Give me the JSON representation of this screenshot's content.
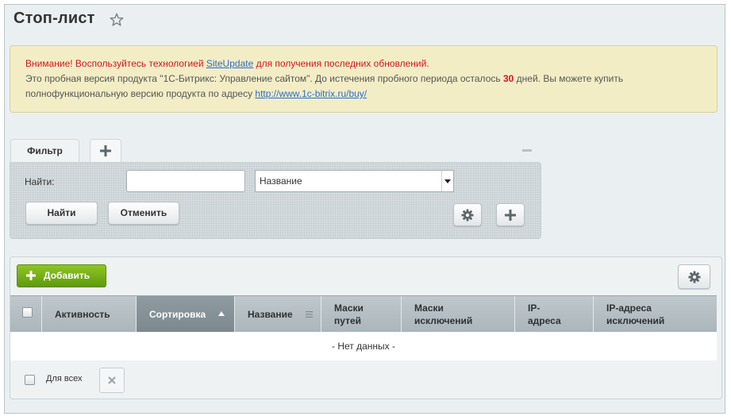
{
  "page": {
    "title": "Стоп-лист"
  },
  "notice": {
    "line1_prefix": "Внимание! Воспользуйтесь технологией ",
    "line1_link": "SiteUpdate",
    "line1_suffix": " для получения последних обновлений.",
    "line2_prefix": "Это пробная версия продукта \"1С-Битрикс: Управление сайтом\". До истечения пробного периода осталось ",
    "line2_days": "30",
    "line2_suffix": " дней. Вы можете купить",
    "line3_prefix": "полнофункциональную версию продукта по адресу ",
    "line3_link": "http://www.1c-bitrix.ru/buy/"
  },
  "filter": {
    "tab_label": "Фильтр",
    "find_label": "Найти:",
    "find_value": "",
    "field_selected": "Название",
    "find_button": "Найти",
    "cancel_button": "Отменить"
  },
  "list": {
    "add_button": "Добавить",
    "columns": [
      {
        "label": "Активность"
      },
      {
        "label": "Сортировка",
        "sort": "asc"
      },
      {
        "label": "Название"
      },
      {
        "label": "Маски\nпутей"
      },
      {
        "label": "Маски\nисключений"
      },
      {
        "label": "IP-\nадреса"
      },
      {
        "label": "IP-адреса\nисключений"
      }
    ],
    "empty_text": "- Нет данных -",
    "for_all_label": "Для всех"
  },
  "colors": {
    "accent_green": "#6aa815",
    "warning_red": "#d8141b",
    "link_blue": "#2b6ccc"
  }
}
